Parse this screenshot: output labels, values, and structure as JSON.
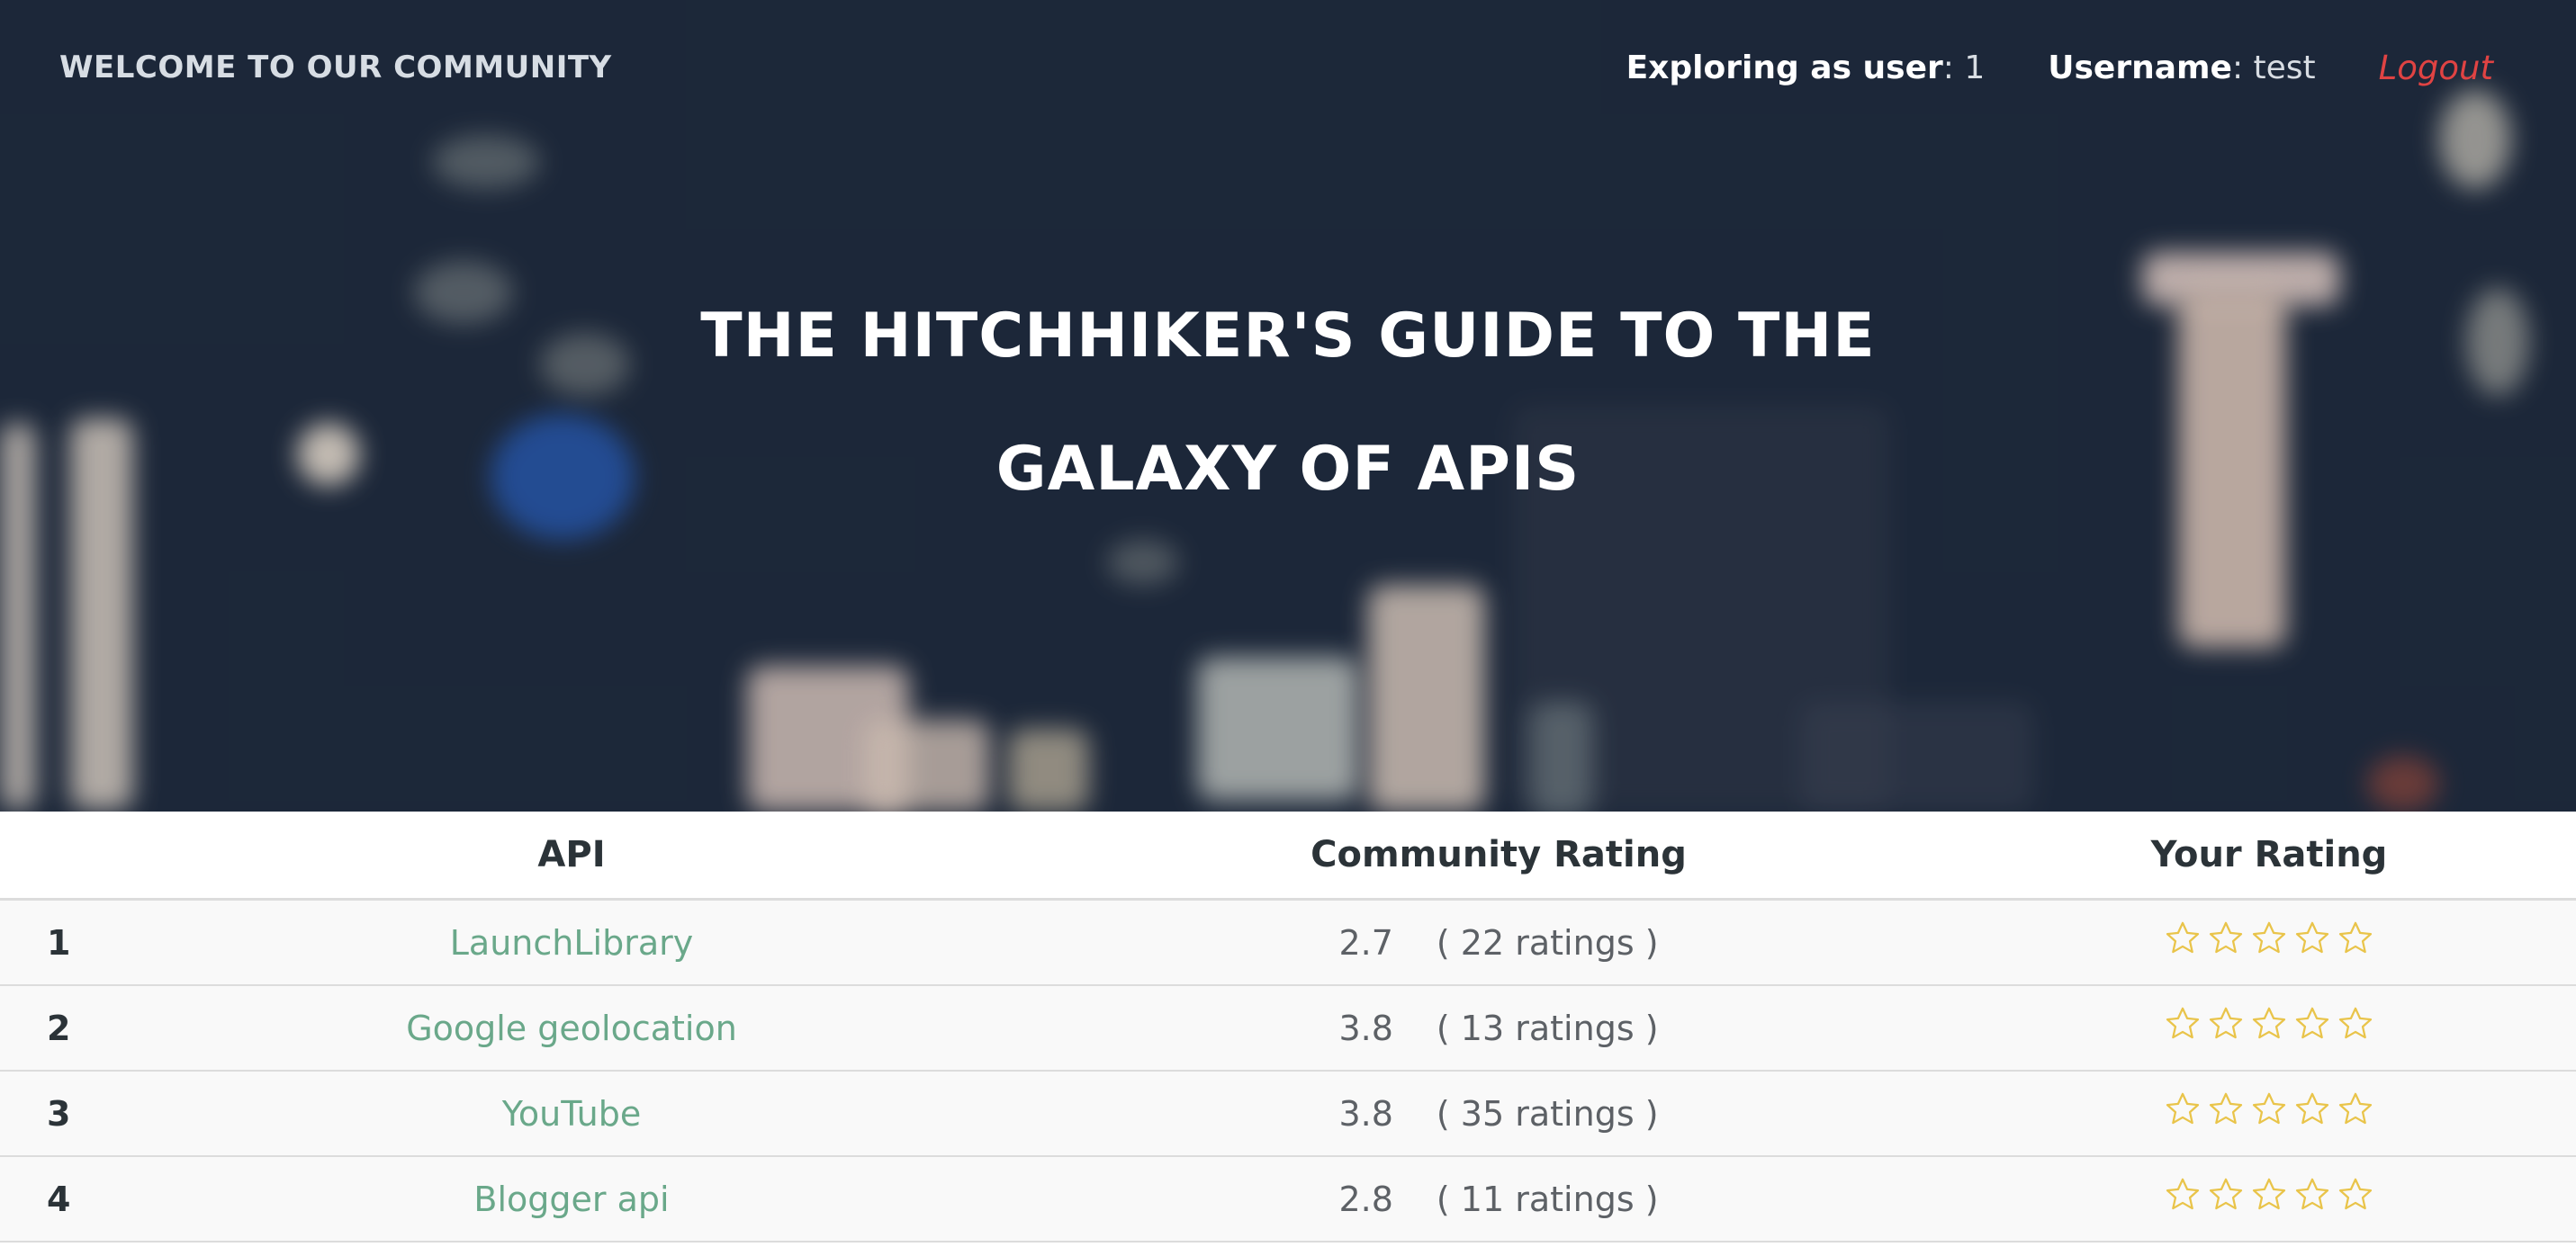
{
  "header": {
    "brand": "WELCOME TO OUR COMMUNITY",
    "exploring_label": "Exploring as user",
    "exploring_value": ": 1",
    "username_label": "Username",
    "username_value": ": test",
    "logout": "Logout"
  },
  "hero": {
    "title_line1": "THE HITCHHIKER'S GUIDE TO THE",
    "title_line2": "GALAXY OF APIS"
  },
  "table": {
    "columns": [
      "",
      "API",
      "Community Rating",
      "Your Rating"
    ],
    "rows": [
      {
        "num": "1",
        "api": "LaunchLibrary",
        "rating": "2.7",
        "count": "( 22 ratings )",
        "your_rating": 0
      },
      {
        "num": "2",
        "api": "Google geolocation",
        "rating": "3.8",
        "count": "( 13 ratings )",
        "your_rating": 0
      },
      {
        "num": "3",
        "api": "YouTube",
        "rating": "3.8",
        "count": "( 35 ratings )",
        "your_rating": 0
      },
      {
        "num": "4",
        "api": "Blogger api",
        "rating": "2.8",
        "count": "( 11 ratings )",
        "your_rating": 0
      }
    ]
  },
  "colors": {
    "accent_link": "#6aa88a",
    "logout": "#e04343",
    "star": "#e9c44a"
  }
}
